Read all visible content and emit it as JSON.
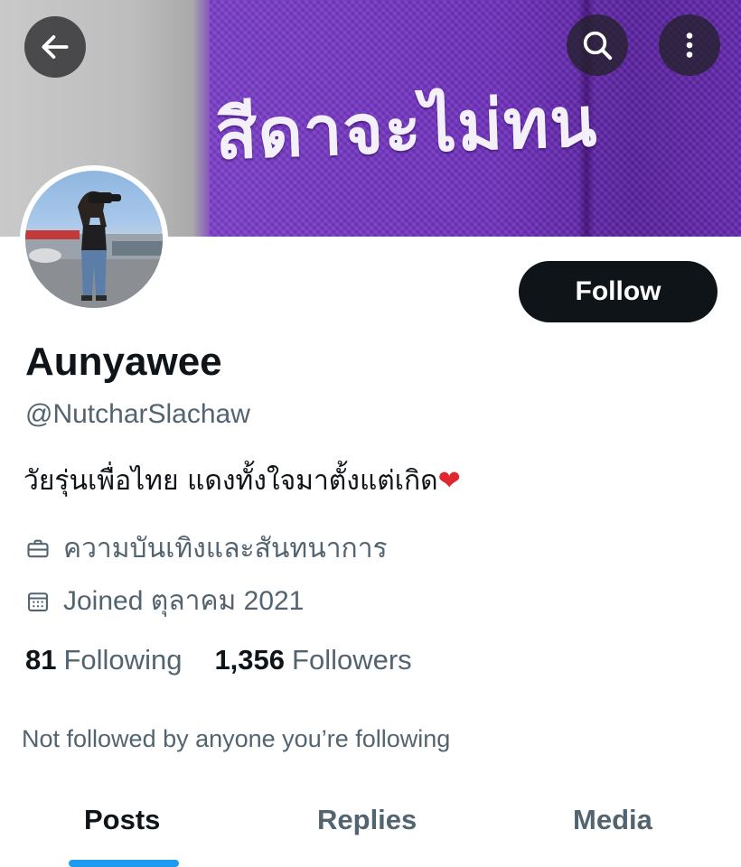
{
  "banner": {
    "embroidered_text": "สีดาจะไม่ทน"
  },
  "header": {
    "back_icon": "arrow-left-icon",
    "search_icon": "search-icon",
    "more_icon": "more-vertical-icon"
  },
  "profile": {
    "display_name": "Aunyawee",
    "handle": "@NutcharSlachaw",
    "bio": "วัยรุ่นเพื่อไทย แดงทั้งใจมาตั้งแต่เกิด",
    "bio_emoji": "❤",
    "category": "ความบันเทิงและสันทนาการ",
    "joined": "Joined ตุลาคม 2021",
    "following_count": "81",
    "following_label": "Following",
    "followers_count": "1,356",
    "followers_label": "Followers",
    "not_followed_text": "Not followed by anyone you’re following"
  },
  "actions": {
    "follow_label": "Follow"
  },
  "tabs": [
    {
      "label": "Posts",
      "active": true
    },
    {
      "label": "Replies",
      "active": false
    },
    {
      "label": "Media",
      "active": false
    }
  ],
  "colors": {
    "accent": "#1d9bf0",
    "text_primary": "#0f1419",
    "text_secondary": "#536471",
    "banner_purple": "#6e30bb",
    "heart": "#e0262f"
  }
}
